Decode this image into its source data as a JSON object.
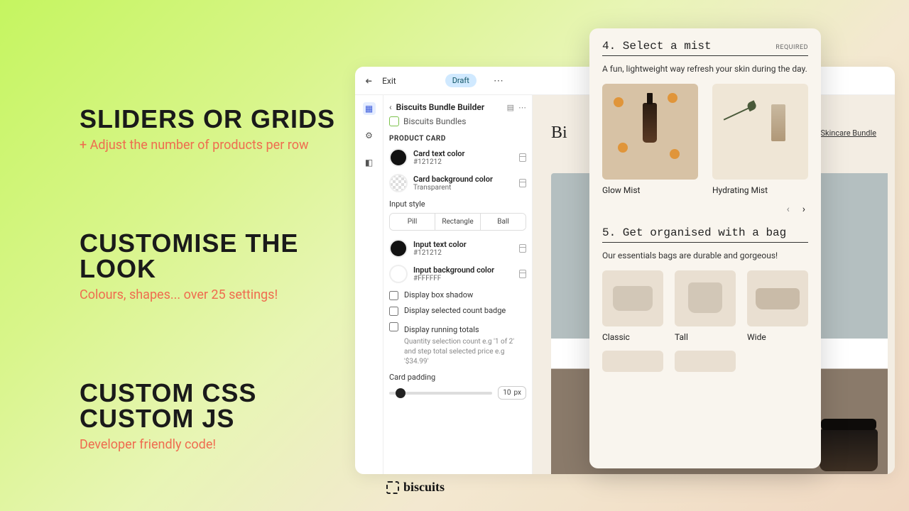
{
  "marketing": {
    "h1": "SLIDERS OR GRIDS",
    "s1": "+ Adjust the number of products per row",
    "h2": "CUSTOMISE THE LOOK",
    "s2": "Colours, shapes... over 25 settings!",
    "h3a": "CUSTOM CSS",
    "h3b": "CUSTOM JS",
    "s3": "Developer friendly code!"
  },
  "editor": {
    "exit": "Exit",
    "draft": "Draft",
    "breadcrumb_title": "Biscuits Bundle Builder",
    "block_name": "Biscuits Bundles",
    "section_label": "PRODUCT CARD",
    "card_text_color": {
      "label": "Card text color",
      "value": "#121212"
    },
    "card_bg_color": {
      "label": "Card background color",
      "value": "Transparent"
    },
    "input_style_label": "Input style",
    "input_styles": {
      "pill": "Pill",
      "rect": "Rectangle",
      "ball": "Ball"
    },
    "input_text_color": {
      "label": "Input text color",
      "value": "#121212"
    },
    "input_bg_color": {
      "label": "Input background color",
      "value": "#FFFFFF"
    },
    "cb_shadow": "Display box shadow",
    "cb_count": "Display selected count badge",
    "cb_totals": "Display running totals",
    "cb_totals_help": "Quantity selection count e.g '1 of 2' and step total selected price e.g '$34.99'",
    "padding_label": "Card padding",
    "padding_value": "10",
    "padding_unit": "px"
  },
  "preview": {
    "title": "Bi",
    "breadcrumb": "Skincare Bundle"
  },
  "mobile": {
    "step4": {
      "title": "4. Select a mist",
      "flag": "REQUIRED",
      "desc": "A fun, lightweight way refresh your skin during the day."
    },
    "products4": [
      {
        "name": "Glow Mist"
      },
      {
        "name": "Hydrating Mist"
      }
    ],
    "step5": {
      "title": "5. Get organised with a bag",
      "desc": "Our essentials bags are durable and gorgeous!"
    },
    "bags": [
      {
        "name": "Classic"
      },
      {
        "name": "Tall"
      },
      {
        "name": "Wide"
      }
    ]
  },
  "logo": "biscuits"
}
